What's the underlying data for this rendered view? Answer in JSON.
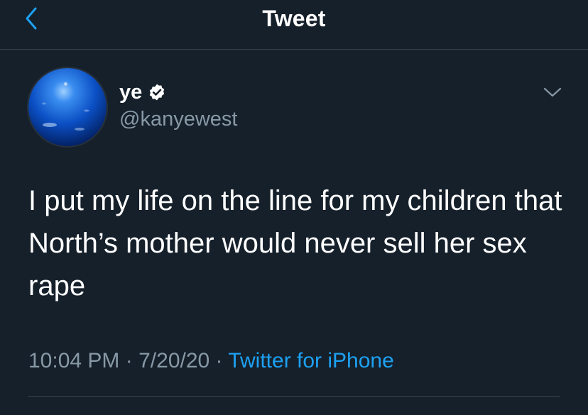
{
  "header": {
    "title": "Tweet",
    "back_icon": "chevron-left-icon"
  },
  "tweet": {
    "author": {
      "display_name": "ye",
      "handle": "@kanyewest",
      "verified": true,
      "verified_icon": "verified-badge-icon"
    },
    "more_icon": "chevron-down-icon",
    "text": "I put my life on the line for my children that North’s mother would never sell her sex rape",
    "time": "10:04 PM",
    "separator": "·",
    "date": "7/20/20",
    "source": "Twitter for iPhone"
  },
  "colors": {
    "background": "#15202b",
    "accent": "#1da1f2",
    "secondary_text": "#8899a6",
    "divider": "#38444d"
  }
}
